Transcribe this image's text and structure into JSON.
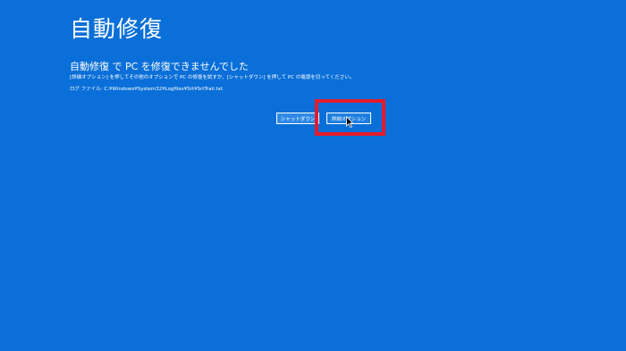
{
  "screen": {
    "title": "自動修復",
    "heading": "自動修復 で PC を修復できませんでした",
    "description": "[詳細オプション] を押してその他のオプションで PC の修復を試すか、[シャットダウン] を押して PC の電源を切ってください。",
    "logfile": "ログ ファイル: C:¥Windows¥System32¥Logfiles¥Srt¥SrtTrail.txt"
  },
  "buttons": {
    "shutdown_label": "シャットダウン",
    "advanced_label": "詳細オプション"
  },
  "colors": {
    "background": "#0a6fd8",
    "highlight": "#e51b2c",
    "text": "#ffffff"
  },
  "icons": {
    "cursor": "mouse-pointer-icon"
  }
}
